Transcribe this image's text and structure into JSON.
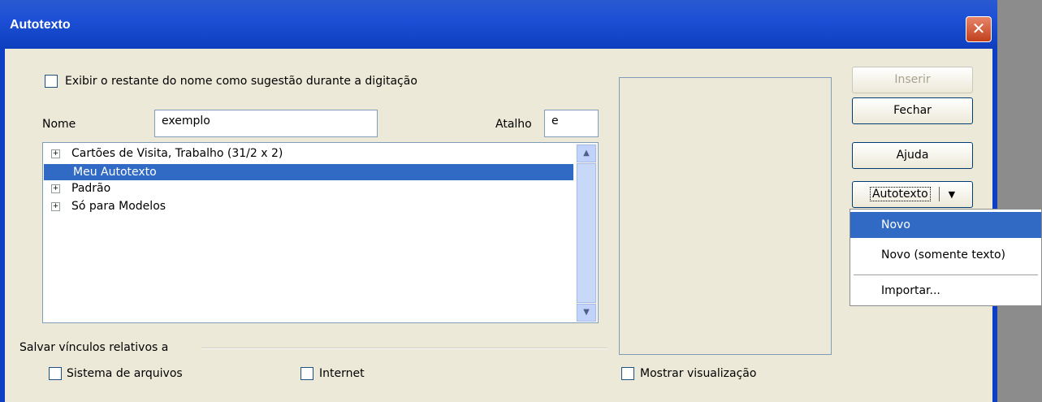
{
  "window": {
    "title": "Autotexto",
    "close_glyph": "✕"
  },
  "options": {
    "show_suggestion_label": "Exibir o restante do nome como sugestão durante a digitação"
  },
  "name_field": {
    "label": "Nome",
    "value": "exemplo"
  },
  "shortcut_field": {
    "label": "Atalho",
    "value": "e"
  },
  "tree": {
    "items": [
      {
        "label": "Cartões de Visita, Trabalho (31/2 x 2)",
        "expandable": true
      },
      {
        "label": "Meu Autotexto",
        "expandable": false,
        "selected": true
      },
      {
        "label": "Padrão",
        "expandable": true
      },
      {
        "label": "Só para Modelos",
        "expandable": true
      }
    ]
  },
  "save_links": {
    "legend": "Salvar vínculos relativos a",
    "filesystem_label": "Sistema de arquivos",
    "internet_label": "Internet"
  },
  "preview": {
    "show_preview_label": "Mostrar visualização"
  },
  "buttons": {
    "insert": "Inserir",
    "close": "Fechar",
    "help": "Ajuda",
    "autotext": "Autotexto"
  },
  "autotext_menu": {
    "items": [
      "Novo",
      "Novo (somente texto)",
      "Importar..."
    ]
  },
  "icons": {
    "expand": "plus-icon",
    "dropdown": "triangle-down-icon",
    "scroll_up": "chevron-up-icon",
    "scroll_down": "chevron-down-icon"
  },
  "colors": {
    "title_bar": "#0d3fbd",
    "selection": "#316ac5",
    "dialog_bg": "#ece9d8"
  }
}
